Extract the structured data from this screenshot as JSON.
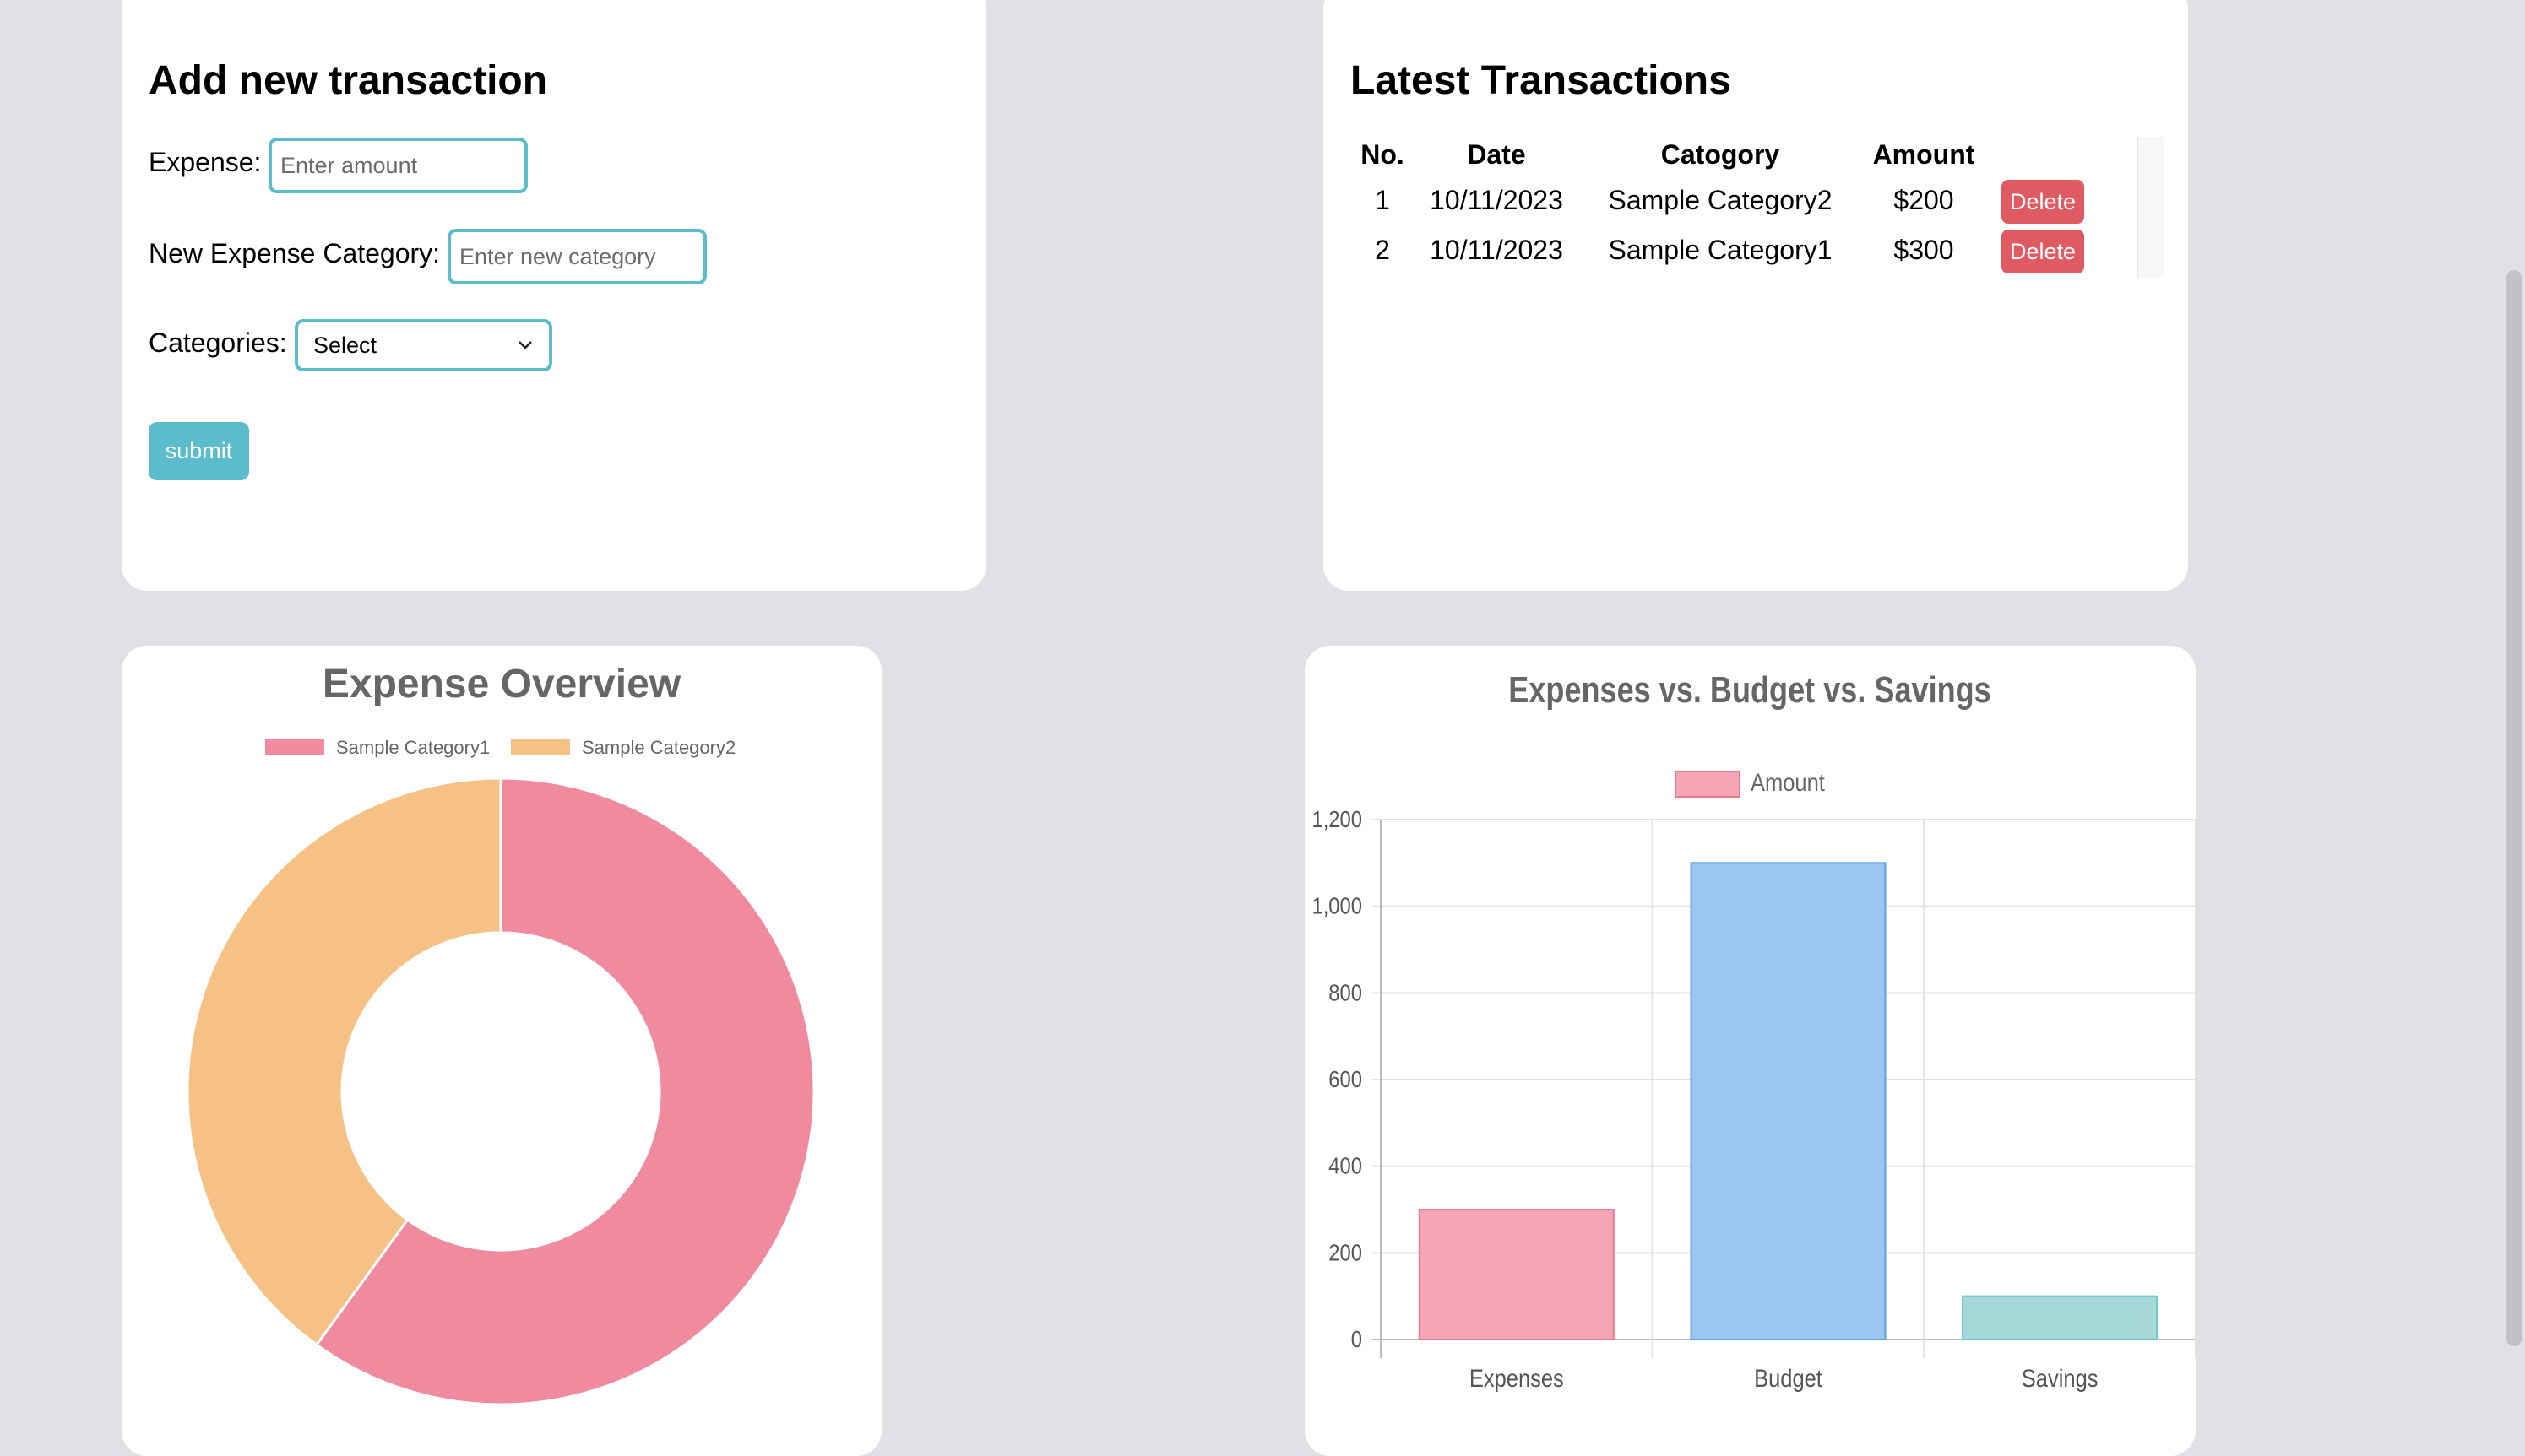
{
  "add_form": {
    "title": "Add new transaction",
    "expense_label": "Expense:",
    "expense_placeholder": "Enter amount",
    "category_label": "New Expense Category:",
    "category_placeholder": "Enter new category",
    "categories_label": "Categories:",
    "categories_selected": "Select",
    "submit_label": "submit"
  },
  "latest": {
    "title": "Latest Transactions",
    "headers": [
      "No.",
      "Date",
      "Catogory",
      "Amount"
    ],
    "rows": [
      {
        "no": "1",
        "date": "10/11/2023",
        "category": "Sample Category2",
        "amount": "$200",
        "action": "Delete"
      },
      {
        "no": "2",
        "date": "10/11/2023",
        "category": "Sample Category1",
        "amount": "$300",
        "action": "Delete"
      }
    ]
  },
  "colors": {
    "accent": "#5bbccb",
    "delete": "#e05a62",
    "pink": "#f08a9e",
    "orange": "#f5c185",
    "blue": "#9bc6ef",
    "teal": "#a6d8da"
  },
  "chart_data": [
    {
      "type": "pie",
      "title": "Expense Overview",
      "labels": [
        "Sample Category1",
        "Sample Category2"
      ],
      "values": [
        300,
        200
      ],
      "colors": [
        "#f08a9e",
        "#f5c185"
      ],
      "legend": "top"
    },
    {
      "type": "bar",
      "title": "Expenses vs. Budget vs. Savings",
      "categories": [
        "Expenses",
        "Budget",
        "Savings"
      ],
      "series": [
        {
          "name": "Amount",
          "values": [
            300,
            1100,
            100
          ]
        }
      ],
      "colors": [
        "#f5a5b4",
        "#9bc6ef",
        "#a6d8da"
      ],
      "ylim": [
        0,
        1200
      ],
      "yticks": [
        "0",
        "200",
        "400",
        "600",
        "800",
        "1,000",
        "1,200"
      ],
      "grid": true,
      "legend": "top"
    }
  ]
}
